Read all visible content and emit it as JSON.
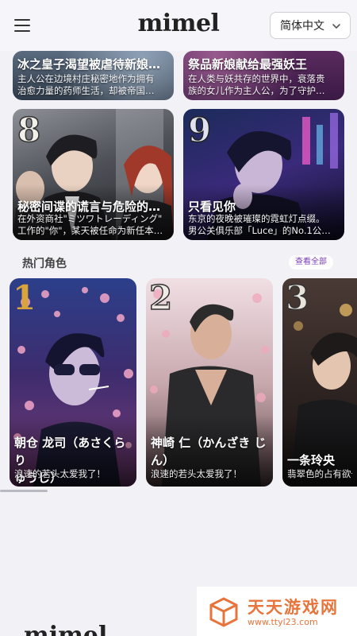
{
  "header": {
    "logo": "mimel",
    "language": "简体中文",
    "menu_icon": "hamburger-menu-icon",
    "dropdown_icon": "chevron-down-icon"
  },
  "top_cards": [
    {
      "title": "冰之皇子渴望被虐待新娘…",
      "desc_lines": [
        "主人公在边境村庄秘密地作为拥有",
        "治愈力量的药师生活，却被帝国…"
      ]
    },
    {
      "title": "祭品新娘献给最强妖王",
      "desc_lines": [
        "在人类与妖共存的世界中，衰落贵",
        "族的女儿作为主人公，为了守护…"
      ]
    }
  ],
  "story_cards": [
    {
      "rank": "8",
      "title": "秘密间谍的谎言与危险的…",
      "desc_lines": [
        "在外资商社\"ミツワトレーディング\"",
        "工作的\"你\"，某天被任命为新任本…"
      ]
    },
    {
      "rank": "9",
      "title": "只看见你",
      "desc_lines": [
        "东京的夜晚被璀璨的霓虹灯点缀。",
        "男公关俱乐部「Luce」的No.1公…"
      ]
    }
  ],
  "section": {
    "title": "热门角色",
    "view_all": "查看全部"
  },
  "characters": [
    {
      "rank": "1",
      "name_lines": [
        "朝仓 龙司（あさくらり",
        "ゅうじ）"
      ],
      "subtitle": "浪速的若头太爱我了！"
    },
    {
      "rank": "2",
      "name_lines": [
        "神崎 仁（かんざき じ",
        "ん）"
      ],
      "subtitle": "浪速的若头太爱我了！"
    },
    {
      "rank": "3",
      "name_lines": [
        "一条玲央"
      ],
      "subtitle": "翡翠色的占有欲一"
    }
  ],
  "watermark": {
    "title": "天天游戏网",
    "url": "www.ttyl23.com"
  },
  "footer": {
    "logo": "mimel"
  },
  "colors": {
    "background": "#f2f1f6",
    "gold_rank": "#d9a53a",
    "view_all_text": "#7a3db8",
    "watermark_orange": "#e8743b"
  }
}
